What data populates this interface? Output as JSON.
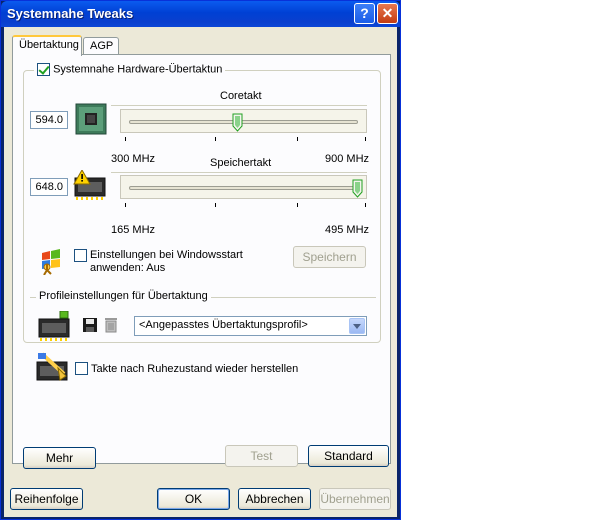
{
  "window": {
    "title": "Systemnahe Tweaks",
    "help_icon": "?",
    "close_icon": "✕"
  },
  "tabs": [
    {
      "label": "Übertaktung",
      "active": true
    },
    {
      "label": "AGP",
      "active": false
    }
  ],
  "overclock_group": {
    "checkbox_label": "Systemnahe Hardware-Übertaktun",
    "checked": true
  },
  "core_slider": {
    "label": "Coretakt",
    "value": "594.0",
    "min_label": "300 MHz",
    "max_label": "900 MHz",
    "level_fraction": 0.49,
    "icon": "chip-icon"
  },
  "memory_slider": {
    "label": "Speichertakt",
    "value": "648.0",
    "min_label": "165 MHz",
    "max_label": "495 MHz",
    "level_fraction": 1.0,
    "icon": "memory-warning-icon"
  },
  "startup": {
    "checkbox_label_line1": "Einstellungen bei Windowsstart",
    "checkbox_label_line2": "anwenden: Aus",
    "checked": false,
    "save_label": "Speichern"
  },
  "profiles": {
    "legend": "Profileinstellungen für Übertaktung",
    "selected": "<Angepasstes Übertaktungsprofil>"
  },
  "resume": {
    "checkbox_label": "Takte nach Ruhezustand wieder herstellen",
    "checked": false
  },
  "buttons": {
    "more": "Mehr",
    "test": "Test",
    "standard": "Standard",
    "order": "Reihenfolge",
    "ok": "OK",
    "cancel": "Abbrechen",
    "apply": "Übernehmen"
  },
  "colors": {
    "titlebar": "#0a46d8",
    "face": "#ece9d8",
    "tab_highlight": "#ffc83c"
  }
}
